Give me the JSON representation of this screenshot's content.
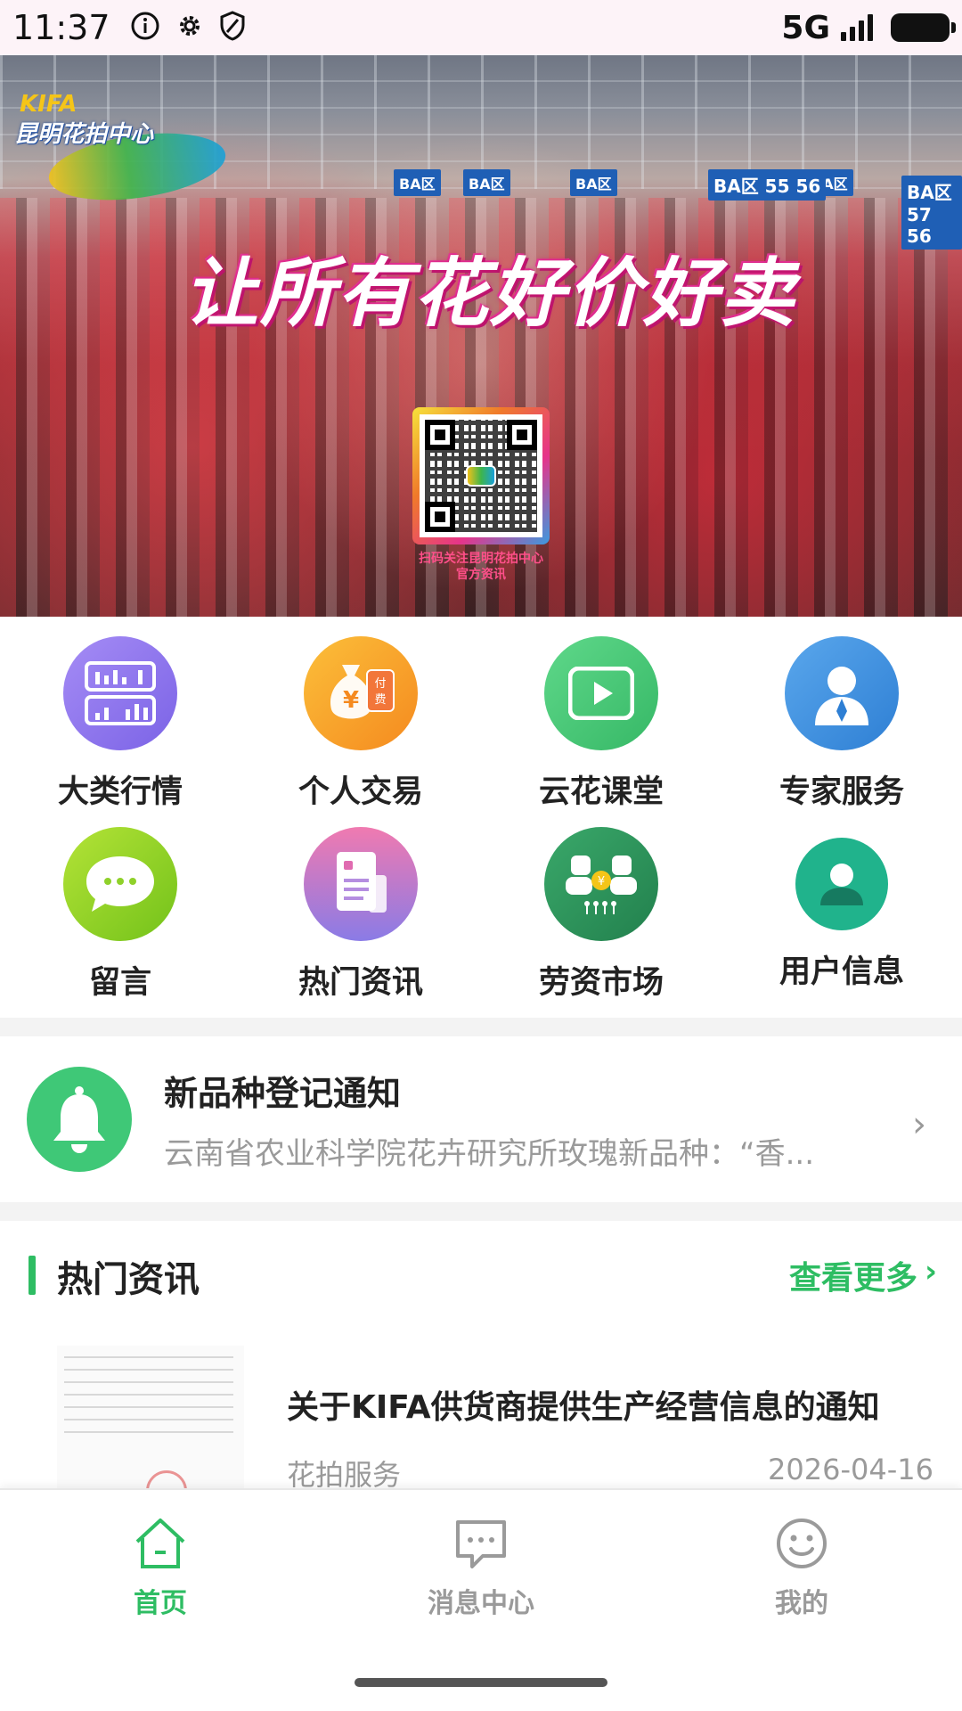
{
  "status_bar": {
    "time": "11:37",
    "network": "5G",
    "icons": [
      "info-icon",
      "gear-icon",
      "shield-icon",
      "signal-icon",
      "battery-icon"
    ]
  },
  "banner": {
    "logo_text": "KIFA",
    "logo_name": "昆明花拍中心",
    "slogan": "让所有花好价好卖",
    "zone_signs": [
      "BA区",
      "BA区",
      "BA区",
      "BA区",
      "BA区 55 56",
      "BA区 57 56"
    ],
    "qr_caption_line1": "扫码关注昆明花拍中心",
    "qr_caption_line2": "官方资讯"
  },
  "grid": {
    "items": [
      {
        "label": "大类行情",
        "icon": "bar-chart-icon",
        "color": "#9b7bf0"
      },
      {
        "label": "个人交易",
        "icon": "money-bag-icon",
        "color": "#f7a025",
        "badge": "付费"
      },
      {
        "label": "云花课堂",
        "icon": "play-icon",
        "color": "#45c774"
      },
      {
        "label": "专家服务",
        "icon": "expert-icon",
        "color": "#3a8de0"
      },
      {
        "label": "留言",
        "icon": "chat-bubble-icon",
        "color": "#8fd12a"
      },
      {
        "label": "热门资讯",
        "icon": "document-icon",
        "color": "#e06bb0"
      },
      {
        "label": "劳资市场",
        "icon": "people-icon",
        "color": "#2e9e5e"
      },
      {
        "label": "用户信息",
        "icon": "user-icon",
        "color": "#20b38c"
      }
    ]
  },
  "notice": {
    "title": "新品种登记通知",
    "description": "云南省农业科学院花卉研究所玫瑰新品种：“香...",
    "icon": "bell-icon"
  },
  "hot_news": {
    "title": "热门资讯",
    "more": "查看更多",
    "items": [
      {
        "title": "关于KIFA供货商提供生产经营信息的通知",
        "source": "花拍服务",
        "date": "2026-04-16"
      }
    ]
  },
  "bottom_nav": {
    "items": [
      {
        "label": "首页",
        "icon": "home-icon",
        "active": true
      },
      {
        "label": "消息中心",
        "icon": "message-icon",
        "active": false
      },
      {
        "label": "我的",
        "icon": "smiley-icon",
        "active": false
      }
    ]
  },
  "colors": {
    "accent": "#2ebd63",
    "muted": "#9a9a9a"
  }
}
